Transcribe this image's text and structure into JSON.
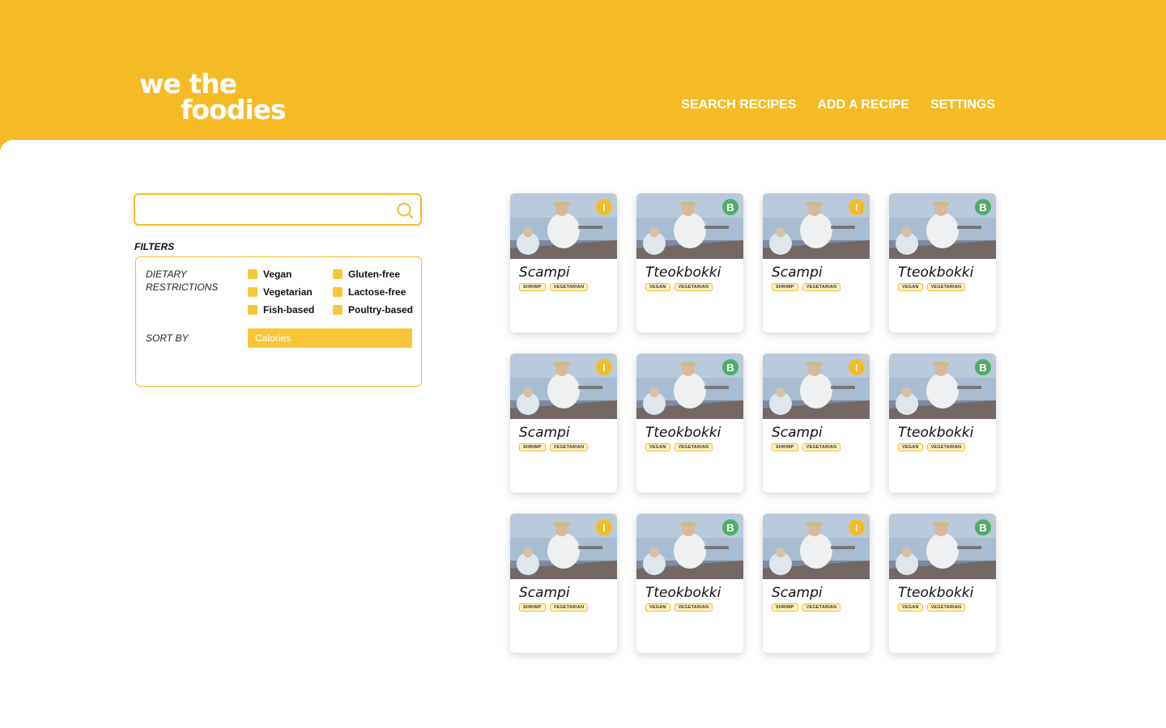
{
  "logo": {
    "line1": "we the",
    "line2": "foodies"
  },
  "nav": {
    "items": [
      {
        "label": "SEARCH RECIPES"
      },
      {
        "label": "ADD A RECIPE"
      },
      {
        "label": "SETTINGS"
      }
    ]
  },
  "search": {
    "value": "",
    "placeholder": ""
  },
  "filters": {
    "title": "FILTERS",
    "dietary_label": "DIETARY RESTRICTIONS",
    "options": [
      "Vegan",
      "Gluten-free",
      "Vegetarian",
      "Lactose-free",
      "Fish-based",
      "Poultry-based"
    ],
    "sort_label": "SORT BY",
    "sort_value": "Calories"
  },
  "colors": {
    "accent": "#F4BB25",
    "badge_intermediate": "#F4BB25",
    "badge_beginner": "#4CAF63"
  },
  "recipes": [
    {
      "title": "Scampi",
      "badge": "I",
      "badge_color": "#F4BB25",
      "tags": [
        "SHRIMP",
        "VEGETARIAN"
      ]
    },
    {
      "title": "Tteokbokki",
      "badge": "B",
      "badge_color": "#4CAF63",
      "tags": [
        "VEGAN",
        "VEGETARIAN"
      ]
    },
    {
      "title": "Scampi",
      "badge": "I",
      "badge_color": "#F4BB25",
      "tags": [
        "SHRIMP",
        "VEGETARIAN"
      ]
    },
    {
      "title": "Tteokbokki",
      "badge": "B",
      "badge_color": "#4CAF63",
      "tags": [
        "VEGAN",
        "VEGETARIAN"
      ]
    },
    {
      "title": "Scampi",
      "badge": "I",
      "badge_color": "#F4BB25",
      "tags": [
        "SHRIMP",
        "VEGETARIAN"
      ]
    },
    {
      "title": "Tteokbokki",
      "badge": "B",
      "badge_color": "#4CAF63",
      "tags": [
        "VEGAN",
        "VEGETARIAN"
      ]
    },
    {
      "title": "Scampi",
      "badge": "I",
      "badge_color": "#F4BB25",
      "tags": [
        "SHRIMP",
        "VEGETARIAN"
      ]
    },
    {
      "title": "Tteokbokki",
      "badge": "B",
      "badge_color": "#4CAF63",
      "tags": [
        "VEGAN",
        "VEGETARIAN"
      ]
    },
    {
      "title": "Scampi",
      "badge": "I",
      "badge_color": "#F4BB25",
      "tags": [
        "SHRIMP",
        "VEGETARIAN"
      ]
    },
    {
      "title": "Tteokbokki",
      "badge": "B",
      "badge_color": "#4CAF63",
      "tags": [
        "VEGAN",
        "VEGETARIAN"
      ]
    },
    {
      "title": "Scampi",
      "badge": "I",
      "badge_color": "#F4BB25",
      "tags": [
        "SHRIMP",
        "VEGETARIAN"
      ]
    },
    {
      "title": "Tteokbokki",
      "badge": "B",
      "badge_color": "#4CAF63",
      "tags": [
        "VEGAN",
        "VEGETARIAN"
      ]
    }
  ]
}
